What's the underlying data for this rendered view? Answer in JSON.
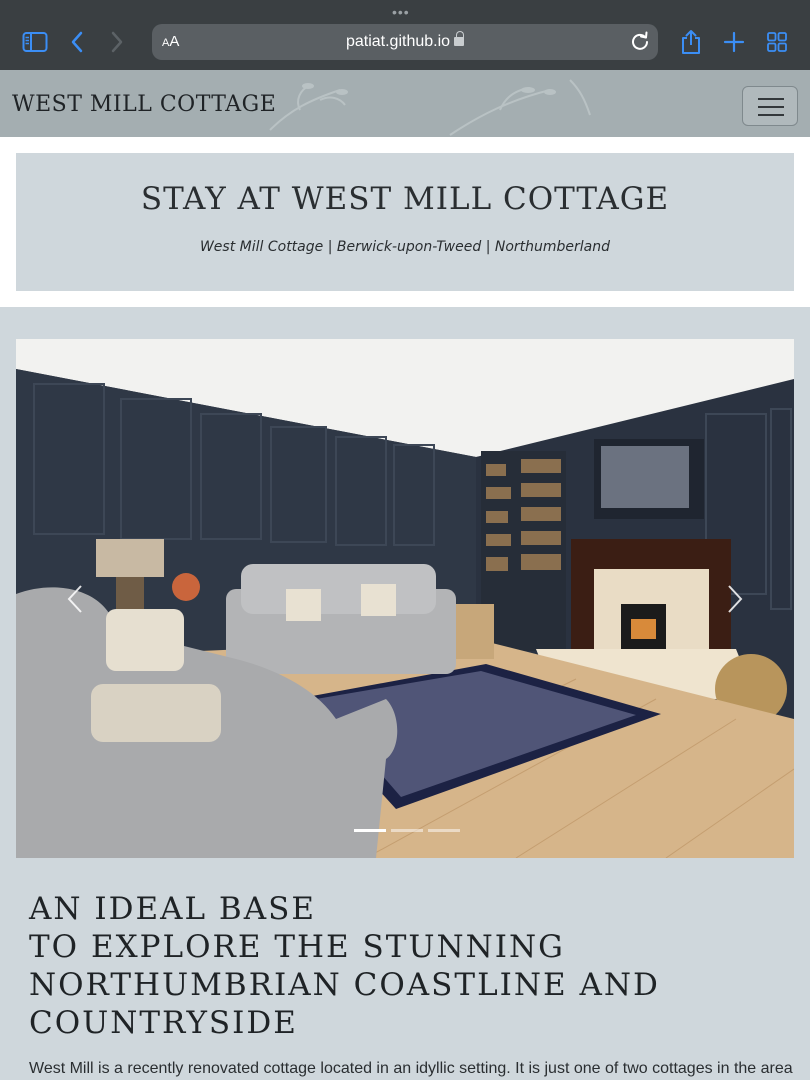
{
  "browser": {
    "url": "patiat.github.io",
    "reader_label_small": "A",
    "reader_label_large": "A"
  },
  "navbar": {
    "brand": "WEST MILL COTTAGE"
  },
  "hero": {
    "title": "STAY AT WEST MILL COTTAGE",
    "subtitle": "West Mill Cottage | Berwick-upon-Tweed | Northumberland"
  },
  "carousel": {
    "slide_count": 3,
    "active_index": 0
  },
  "intro": {
    "heading_lines": [
      "AN IDEAL BASE",
      "TO EXPLORE THE STUNNING",
      "NORTHUMBRIAN COASTLINE AND",
      "COUNTRYSIDE"
    ],
    "text": "West Mill is a recently renovated cottage located in an idyllic setting. It is just one of two cottages in the area"
  },
  "colors": {
    "browser_chrome": "#3a3f42",
    "accent_blue": "#3b8ef5",
    "navbar_bg": "#a4aeb1",
    "page_bg": "#cfd7dc"
  }
}
